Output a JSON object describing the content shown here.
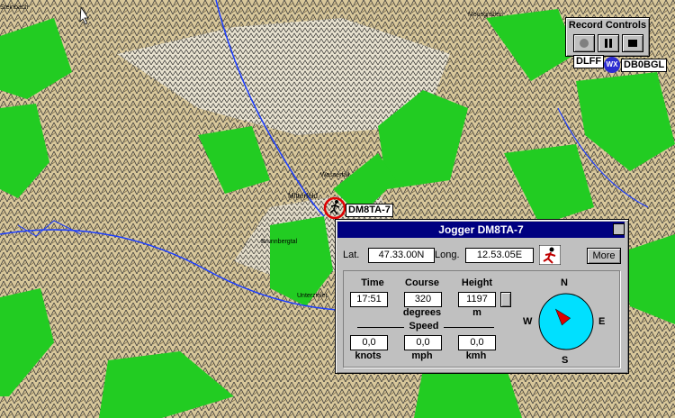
{
  "map": {
    "callsign": "DM8TA-7",
    "place_labels": [
      "Mitterfeld",
      "Wasserfall",
      "Unterzieler",
      "Steinbach",
      "Brunnbergtal",
      "Moosgraben"
    ]
  },
  "record_controls": {
    "title": "Record Controls",
    "play_icon": "record-icon",
    "pause_icon": "pause-icon",
    "stop_icon": "stop-icon"
  },
  "stations": {
    "left": "DLFF",
    "wx": "WX",
    "right": "DB0BGL"
  },
  "window": {
    "title": "Jogger  DM8TA-7",
    "lat_label": "Lat.",
    "lat": "47.33.00N",
    "long_label": "Long.",
    "long": "12.53.05E",
    "more_label": "More",
    "time_label": "Time",
    "time": "17:51",
    "course_label": "Course",
    "course": "320",
    "course_unit": "degrees",
    "height_label": "Height",
    "height": "1197",
    "height_unit": "m",
    "speed_label": "Speed",
    "knots": "0,0",
    "knots_unit": "knots",
    "mph": "0,0",
    "mph_unit": "mph",
    "kmh": "0,0",
    "kmh_unit": "kmh",
    "compass": {
      "n": "N",
      "s": "S",
      "e": "E",
      "w": "W",
      "heading_degrees": 320
    }
  }
}
